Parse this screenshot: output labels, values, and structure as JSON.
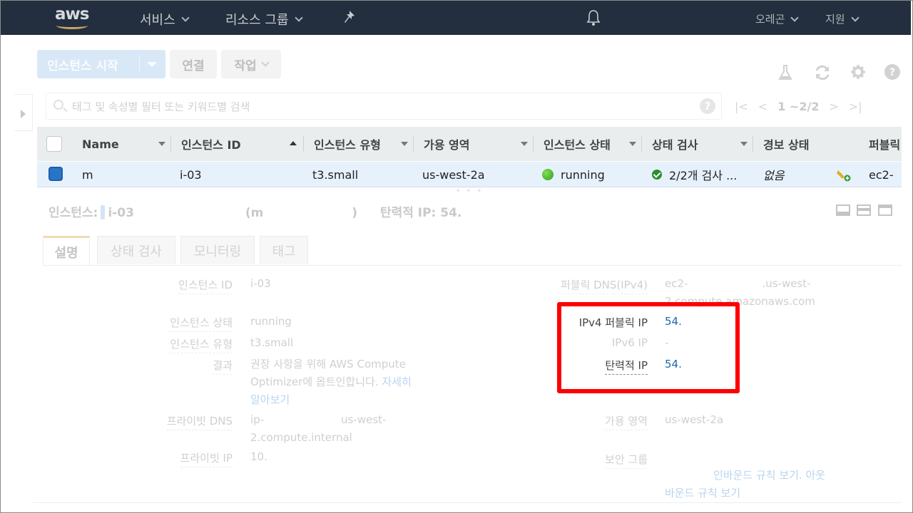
{
  "topnav": {
    "logo": "aws",
    "services": "서비스",
    "resource_groups": "리소스 그룹",
    "pin_icon": "pin-icon",
    "bell_icon": "bell-icon",
    "account": "오레곤",
    "support": "지원"
  },
  "actions": {
    "launch": "인스턴스 시작",
    "connect": "연결",
    "actions": "작업"
  },
  "toolbar_icons": [
    "flask-icon",
    "refresh-icon",
    "gear-icon",
    "help-icon"
  ],
  "search": {
    "placeholder": "태그 및 속성별 필터 또는 키워드별 검색",
    "help": "?"
  },
  "pager": {
    "first": "|<",
    "prev": "<",
    "range": "1 ~2/2",
    "next": ">",
    "last": ">|"
  },
  "table": {
    "columns": [
      "Name",
      "인스턴스 ID",
      "인스턴스 유형",
      "가용 영역",
      "인스턴스 상태",
      "상태 검사",
      "경보 상태",
      "퍼블릭"
    ],
    "rows": [
      {
        "name": "m",
        "instance_id": "i-03",
        "instance_type": "t3.small",
        "az": "us-west-2a",
        "state": "running",
        "status_check": "2/2개 검사 ...",
        "alarm": "없음",
        "public": "ec2-"
      }
    ]
  },
  "details": {
    "header_label": "인스턴스:",
    "header_id": "i-03",
    "header_name_open": "(m",
    "header_name_close": ")",
    "header_eip": "탄력적 IP: 54.",
    "tabs": [
      "설명",
      "상태 검사",
      "모니터링",
      "태그"
    ]
  },
  "fields_left": {
    "instance_id_label": "인스턴스 ID",
    "instance_id": "i-03",
    "state_label": "인스턴스 상태",
    "state": "running",
    "type_label": "인스턴스 유형",
    "type": "t3.small",
    "finding_label": "결과",
    "finding_line1": "권장 사항을 위해 AWS Compute",
    "finding_line2_a": "Optimizer에 옵트인합니다. ",
    "finding_link_a": "자세히",
    "finding_link_b": "알아보기",
    "private_dns_label": "프라이빗 DNS",
    "private_dns_line1": "ip-",
    "private_dns_line1b": "us-west-",
    "private_dns_line2": "2.compute.internal",
    "private_ip_label": "프라이빗 IP",
    "private_ip": "10."
  },
  "fields_right": {
    "public_dns_label": "퍼블릭 DNS(IPv4)",
    "public_dns_line1": "ec2-",
    "public_dns_line1b": ".us-west-",
    "public_dns_line2": "2.compute.amazonaws.com",
    "ipv4_label": "IPv4 퍼블릭 IP",
    "ipv4": "54.",
    "ipv6_label": "IPv6 IP",
    "ipv6": "-",
    "eip_label": "탄력적 IP",
    "eip": "54.",
    "az_label": "가용 영역",
    "az": "us-west-2a",
    "sg_label": "보안 그룹",
    "sg_link_line1": "인바운드 규칙 보기. 아웃",
    "sg_link_line2": "바운드 규칙 보기"
  },
  "highlight_color": "#ff0000"
}
